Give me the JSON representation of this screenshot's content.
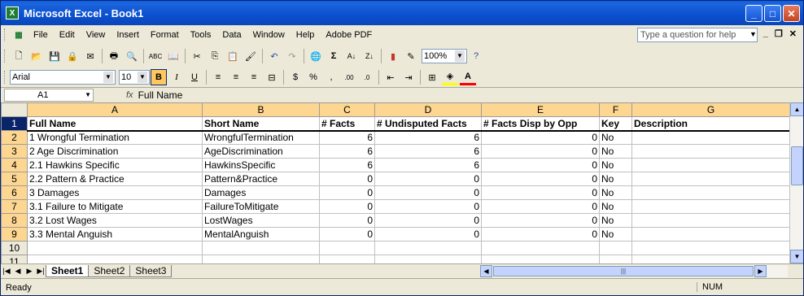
{
  "window": {
    "title": "Microsoft Excel - Book1",
    "app_icon": "X"
  },
  "menu": {
    "items": [
      "File",
      "Edit",
      "View",
      "Insert",
      "Format",
      "Tools",
      "Data",
      "Window",
      "Help",
      "Adobe PDF"
    ],
    "help_placeholder": "Type a question for help"
  },
  "toolbar": {
    "zoom": "100%",
    "font": "Arial",
    "size": "10"
  },
  "formula": {
    "cell_ref": "A1",
    "fx": "fx",
    "content": "Full Name"
  },
  "columns": [
    "A",
    "B",
    "C",
    "D",
    "E",
    "F",
    "G"
  ],
  "rows": [
    {
      "num": "1",
      "cells": [
        "Full Name",
        "Short Name",
        "# Facts",
        "# Undisputed Facts",
        "# Facts Disp by Opp",
        "Key",
        "Description"
      ]
    },
    {
      "num": "2",
      "cells": [
        "1 Wrongful Termination",
        "WrongfulTermination",
        "6",
        "6",
        "0",
        "No",
        ""
      ]
    },
    {
      "num": "3",
      "cells": [
        "2 Age Discrimination",
        "AgeDiscrimination",
        "6",
        "6",
        "0",
        "No",
        ""
      ]
    },
    {
      "num": "4",
      "cells": [
        "2.1 Hawkins Specific",
        "HawkinsSpecific",
        "6",
        "6",
        "0",
        "No",
        ""
      ]
    },
    {
      "num": "5",
      "cells": [
        "2.2 Pattern & Practice",
        "Pattern&Practice",
        "0",
        "0",
        "0",
        "No",
        ""
      ]
    },
    {
      "num": "6",
      "cells": [
        "3 Damages",
        "Damages",
        "0",
        "0",
        "0",
        "No",
        ""
      ]
    },
    {
      "num": "7",
      "cells": [
        "3.1 Failure to Mitigate",
        "FailureToMitigate",
        "0",
        "0",
        "0",
        "No",
        ""
      ]
    },
    {
      "num": "8",
      "cells": [
        "3.2 Lost Wages",
        "LostWages",
        "0",
        "0",
        "0",
        "No",
        ""
      ]
    },
    {
      "num": "9",
      "cells": [
        "3.3 Mental Anguish",
        "MentalAnguish",
        "0",
        "0",
        "0",
        "No",
        ""
      ]
    },
    {
      "num": "10",
      "cells": [
        "",
        "",
        "",
        "",
        "",
        "",
        ""
      ]
    },
    {
      "num": "11",
      "cells": [
        "",
        "",
        "",
        "",
        "",
        "",
        ""
      ]
    }
  ],
  "tabs": [
    "Sheet1",
    "Sheet2",
    "Sheet3"
  ],
  "status": {
    "ready": "Ready",
    "num": "NUM"
  }
}
